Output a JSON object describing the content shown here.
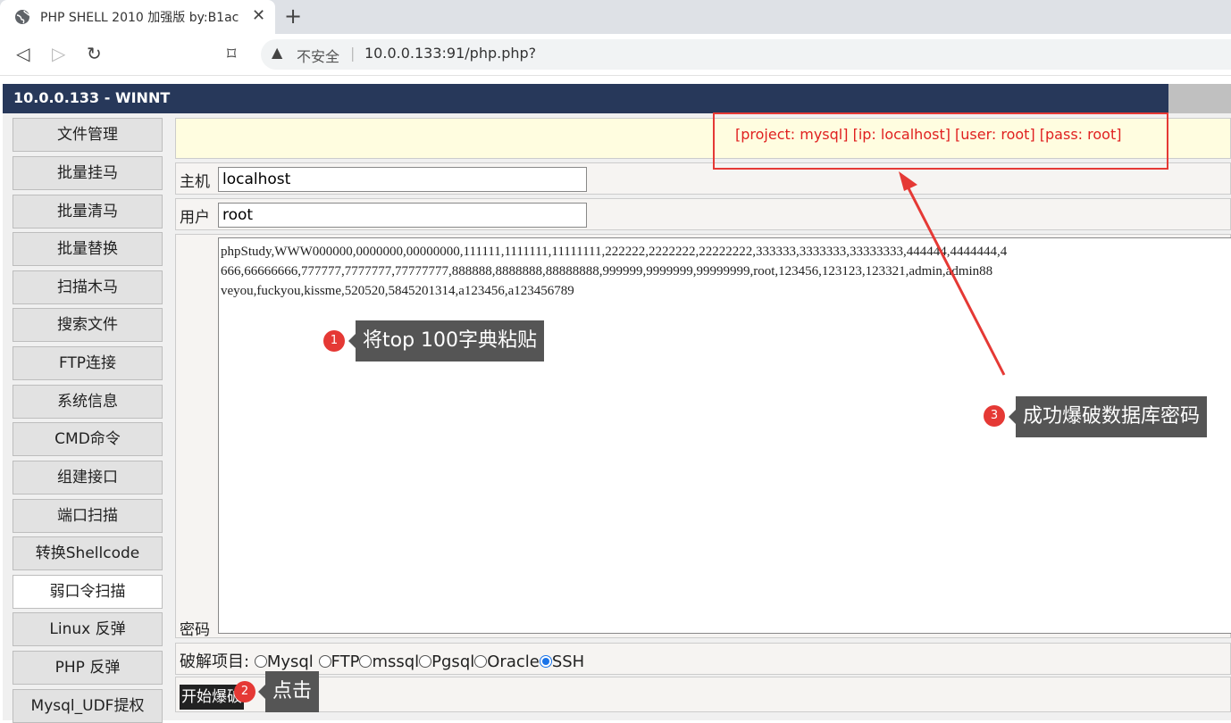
{
  "browser": {
    "tab_title": "PHP SHELL 2010 加强版 by:B1ac",
    "tab_close": "✕",
    "new_tab": "+",
    "back": "◁",
    "forward": "▷",
    "reload": "↻",
    "bookmark": "⌑",
    "warn_icon": "▲",
    "insecure": "不安全",
    "url": "10.0.0.133:91/php.php?"
  },
  "header": {
    "title": "10.0.0.133 - WINNT"
  },
  "sidebar": {
    "items": [
      "文件管理",
      "批量挂马",
      "批量清马",
      "批量替换",
      "扫描木马",
      "搜索文件",
      "FTP连接",
      "系统信息",
      "CMD命令",
      "组建接口",
      "端口扫描",
      "转换Shellcode",
      "弱口令扫描",
      "Linux 反弹",
      "PHP 反弹",
      "Mysql_UDF提权"
    ],
    "active": "弱口令扫描"
  },
  "result": {
    "text": "[project: mysql] [ip: localhost] [user: root] [pass: root]"
  },
  "form": {
    "host_label": "主机",
    "host_value": "localhost",
    "user_label": "用户",
    "user_value": "root",
    "pass_label": "密码",
    "pass_value": "phpStudy,WWW000000,0000000,00000000,111111,1111111,11111111,222222,2222222,22222222,333333,3333333,33333333,444444,4444444,4\n666,66666666,777777,7777777,77777777,888888,8888888,88888888,999999,9999999,99999999,root,123456,123123,123321,admin,admin88\nveyou,fuckyou,kissme,520520,5845201314,a123456,a123456789",
    "project_label": "破解项目:",
    "options": [
      "Mysql",
      "FTP",
      "mssql",
      "Pgsql",
      "Oracle",
      "SSH"
    ],
    "selected": "SSH",
    "start_button": "开始爆破"
  },
  "annotations": {
    "a1_num": "1",
    "a1_text": "将top 100字典粘贴",
    "a2_num": "2",
    "a2_text": "点击",
    "a3_num": "3",
    "a3_text": "成功爆破数据库密码",
    "color": "#e53935"
  }
}
